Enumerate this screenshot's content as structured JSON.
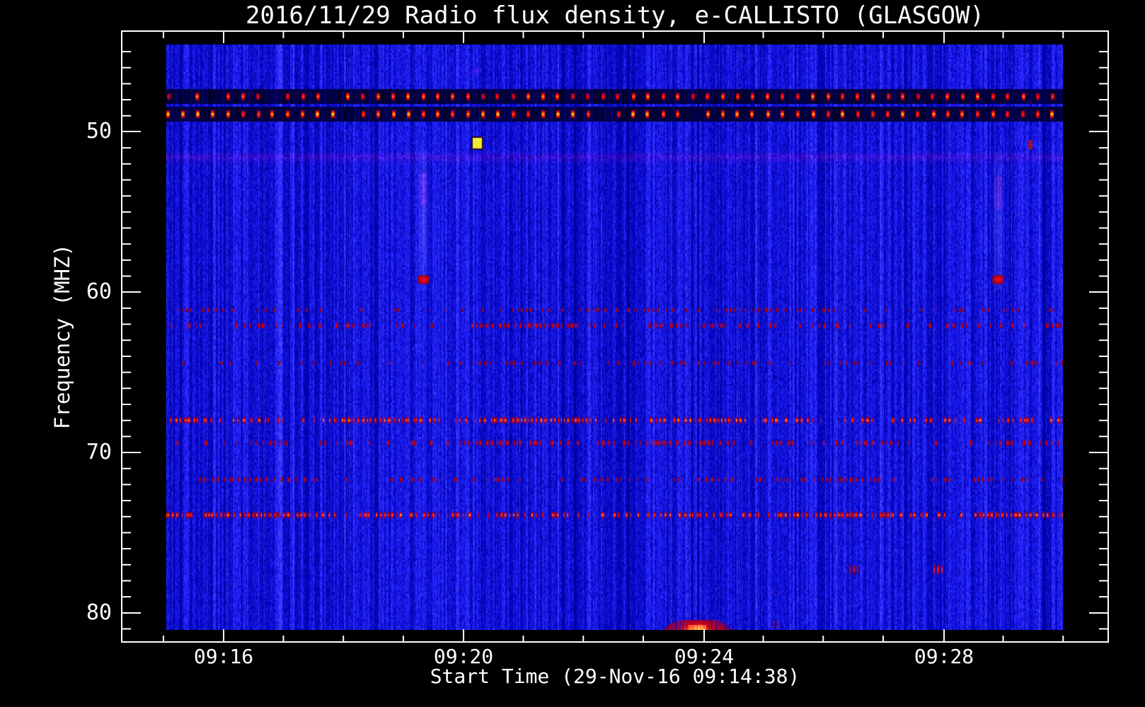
{
  "chart_data": {
    "type": "heatmap",
    "title": "2016/11/29  Radio flux density, e-CALLISTO (GLASGOW)",
    "xlabel": "Start Time (29-Nov-16 09:14:38)",
    "ylabel": "Frequency (MHZ)",
    "x_axis": {
      "major_ticks": [
        {
          "label": "09:16",
          "frac": 0.1033
        },
        {
          "label": "09:20",
          "frac": 0.3465
        },
        {
          "label": "09:24",
          "frac": 0.5904
        },
        {
          "label": "09:28",
          "frac": 0.8336
        }
      ],
      "minor_tick_start_frac": 0.0423,
      "minor_tick_step_frac": 0.0608,
      "minor_tick_count": 16,
      "minor_tick_interval": "1 min"
    },
    "y_axis": {
      "unit": "MHz",
      "major_ticks": [
        {
          "label": "50",
          "frac": 0.1644
        },
        {
          "label": "60",
          "frac": 0.4271
        },
        {
          "label": "70",
          "frac": 0.6898
        },
        {
          "label": "80",
          "frac": 0.9525
        }
      ],
      "minor_start_frac": 0.0336,
      "minor_step_frac": 0.02625,
      "minor_count": 37,
      "minor_tick_interval_mhz": 1
    },
    "data_extent": {
      "x0_frac": 0.0452,
      "x1_frac": 0.954,
      "y0_frac": 0.022,
      "y1_frac": 0.9803,
      "time_span": [
        "09:15",
        "09:30"
      ],
      "freq_span_mhz": [
        44.6,
        81.1
      ]
    },
    "periodic_bands": [
      {
        "freq_mhz": 47.8,
        "strip_halfwidth_mhz": 0.45,
        "dash_period_s": 15,
        "brightness": 0.82
      },
      {
        "freq_mhz": 48.9,
        "strip_halfwidth_mhz": 0.45,
        "dash_period_s": 15,
        "brightness": 1.0
      }
    ],
    "rfi_bands": [
      {
        "freq_mhz": 61.1,
        "strength": 0.3
      },
      {
        "freq_mhz": 62.1,
        "strength": 0.5
      },
      {
        "freq_mhz": 64.4,
        "strength": 0.32
      },
      {
        "freq_mhz": 68.0,
        "strength": 0.85
      },
      {
        "freq_mhz": 69.4,
        "strength": 0.52
      },
      {
        "freq_mhz": 71.7,
        "strength": 0.4
      },
      {
        "freq_mhz": 73.9,
        "strength": 0.85
      }
    ],
    "features": {
      "purple_band_mhz": 51.6,
      "point_source": {
        "x_frac": 0.36,
        "freq_mhz": 50.7
      },
      "purple_dot": {
        "x_frac": 0.36,
        "freq_mhz": 46.2
      },
      "calibration_streaks": [
        {
          "x_frac": 0.3056,
          "freq_top_mhz": 51.0,
          "freq_bottom_mhz": 59.6,
          "blob_freq_mhz": 59.2,
          "tinge_top_mhz": 52.6,
          "tinge_bottom_mhz": 54.6
        },
        {
          "x_frac": 0.8881,
          "freq_top_mhz": 51.2,
          "freq_bottom_mhz": 59.6,
          "blob_freq_mhz": 59.2,
          "tinge_top_mhz": 52.8,
          "tinge_bottom_mhz": 54.8
        }
      ],
      "bottom_burst": {
        "x_frac": 0.583,
        "freq_mhz": 80.8
      },
      "bottom_marks": {
        "x_frac": 0.66,
        "freq_mhz": 80.6
      },
      "spot_clusters_77mhz": [
        {
          "x_frac": 0.742,
          "freq_mhz": 77.3,
          "strength": 0.65
        },
        {
          "x_frac": 0.827,
          "freq_mhz": 77.3,
          "strength": 1.0
        }
      ],
      "right_edge_mark": {
        "x_frac": 0.921,
        "freq_mhz": 50.8
      }
    },
    "palette": {
      "page_bg": "#000000",
      "frame": "#ffffff",
      "text": "#ffffff",
      "noise_base": "#0d0dd0",
      "noise_dark": "#0202a8",
      "noise_light": "#3535ee",
      "strip_dark": "#000030",
      "rfi_red": "#c80f00",
      "rfi_orange": "#ff6a00",
      "hot_yellow": "#eaea3c",
      "purple_tint": "#7a2090",
      "blob_red": "#c81414",
      "burst_core": "#ffd24a"
    }
  }
}
